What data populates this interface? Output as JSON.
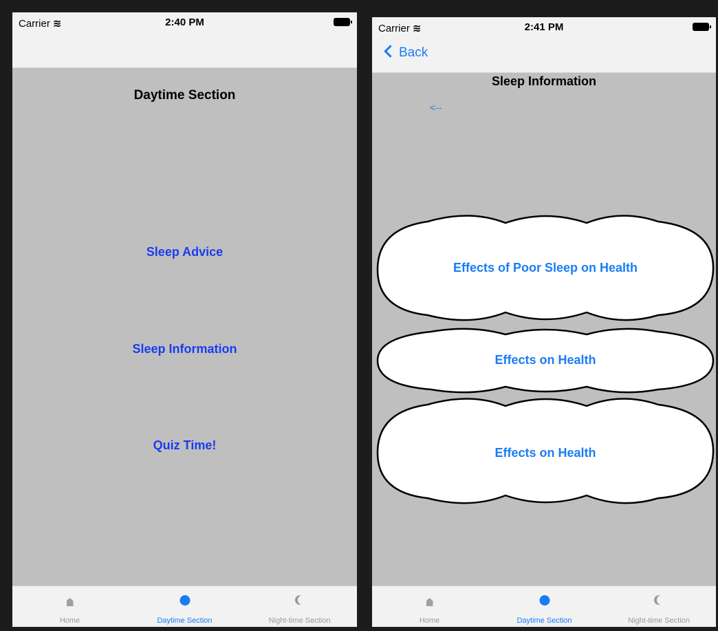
{
  "left": {
    "status": {
      "carrier": "Carrier",
      "time": "2:40 PM"
    },
    "title": "Daytime Section",
    "links": [
      "Sleep Advice",
      "Sleep Information",
      "Quiz Time!"
    ],
    "tabs": [
      {
        "label": "Home",
        "icon": "house-icon",
        "active": false
      },
      {
        "label": "Daytime Section",
        "icon": "dot-icon",
        "active": true
      },
      {
        "label": "Night-time Section",
        "icon": "moon-icon",
        "active": false
      }
    ]
  },
  "right": {
    "status": {
      "carrier": "Carrier",
      "time": "2:41 PM"
    },
    "back_label": "Back",
    "title": "Sleep Information",
    "arrow_link": "<--",
    "clouds": [
      "Effects of Poor Sleep on Health",
      "Effects on Health",
      "Effects on Health"
    ],
    "tabs": [
      {
        "label": "Home",
        "icon": "house-icon",
        "active": false
      },
      {
        "label": "Daytime Section",
        "icon": "dot-icon",
        "active": true
      },
      {
        "label": "Night-time Section",
        "icon": "moon-icon",
        "active": false
      }
    ]
  },
  "colors": {
    "link_blue": "#1a3cf0",
    "system_blue": "#1a7cf5",
    "background": "#bfbfbf"
  }
}
